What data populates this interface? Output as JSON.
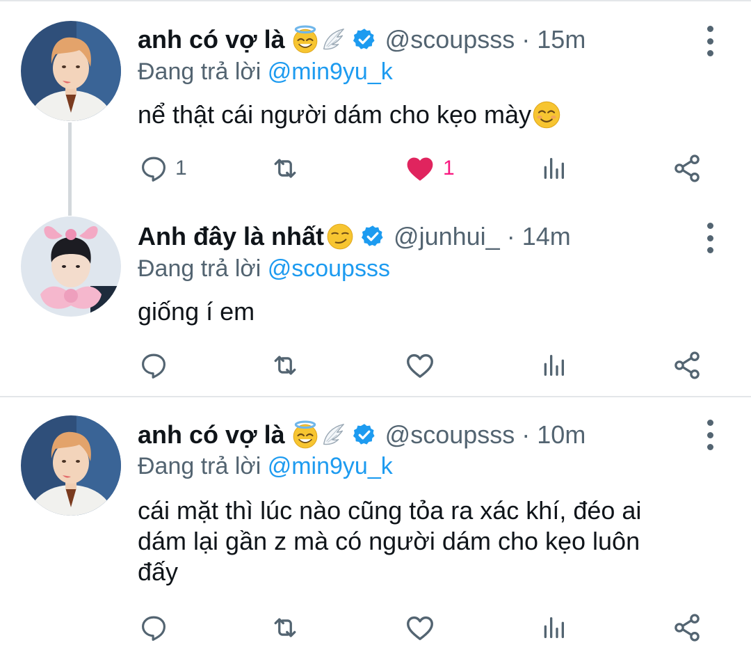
{
  "colors": {
    "text": "#0f1419",
    "secondary": "#536471",
    "accent": "#1d9bf0",
    "like": "#f91880"
  },
  "tweets": [
    {
      "name": "anh có vợ là",
      "name_emojis": [
        "smiling-face-with-halo",
        "wing"
      ],
      "verified": true,
      "handle": "@scoupsss",
      "separator": "·",
      "time": "15m",
      "replying_prefix": "Đang trả lời",
      "replying_to": "@min9yu_k",
      "text": "nể thật cái người dám cho kẹo mày",
      "text_emoji": "smiling-face-with-smiling-eyes",
      "reply_count": "1",
      "like_count": "1",
      "liked": true
    },
    {
      "name": "Anh đây là nhất",
      "name_emojis": [
        "smirking-face"
      ],
      "verified": true,
      "handle": "@junhui_",
      "separator": "·",
      "time": "14m",
      "replying_prefix": "Đang trả lời",
      "replying_to": "@scoupsss",
      "text": "giống í em",
      "reply_count": "",
      "like_count": "",
      "liked": false
    },
    {
      "name": "anh có vợ là",
      "name_emojis": [
        "smiling-face-with-halo",
        "wing"
      ],
      "verified": true,
      "handle": "@scoupsss",
      "separator": "·",
      "time": "10m",
      "replying_prefix": "Đang trả lời",
      "replying_to": "@min9yu_k",
      "text_lines": [
        "cái mặt thì lúc nào cũng tỏa ra xác khí, đéo ai",
        "dám lại gần z mà có người dám cho kẹo luôn",
        "đấy"
      ],
      "reply_count": "",
      "like_count": "",
      "liked": false
    }
  ]
}
